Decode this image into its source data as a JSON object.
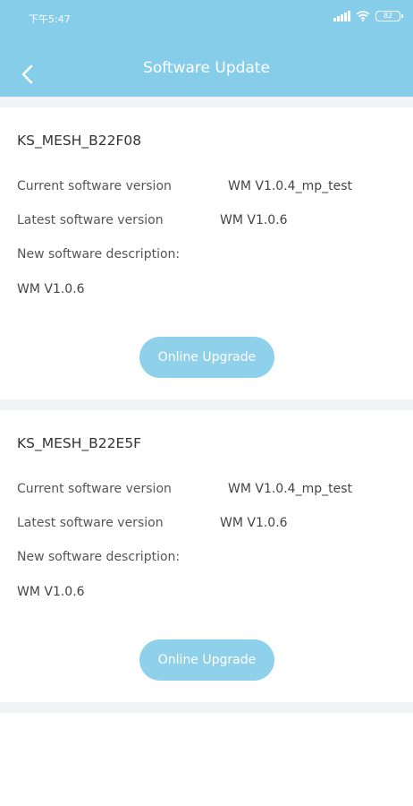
{
  "status_bar": {
    "time": "下午5:47",
    "battery": "82",
    "icons": [
      "signal-icon",
      "wifi-icon",
      "battery-icon"
    ]
  },
  "header": {
    "title": "Software Update",
    "back_icon": "chevron-left-icon",
    "background": "#86cde9"
  },
  "devices": [
    {
      "name": "KS_MESH_B22F08",
      "current_label": "Current software version",
      "current_value": "WM V1.0.4_mp_test",
      "latest_label": "Latest software version",
      "latest_value": "WM V1.0.6",
      "desc_label": "New software description:",
      "desc_value": "WM V1.0.6",
      "button_label": "Online Upgrade"
    },
    {
      "name": "KS_MESH_B22E5F",
      "current_label": "Current software version",
      "current_value": "WM V1.0.4_mp_test",
      "latest_label": "Latest software version",
      "latest_value": "WM V1.0.6",
      "desc_label": "New software description:",
      "desc_value": "WM V1.0.6",
      "button_label": "Online Upgrade"
    }
  ],
  "colors": {
    "accent": "#86cde9",
    "button": "#8fd0ea",
    "divider": "#f2f3f5"
  }
}
